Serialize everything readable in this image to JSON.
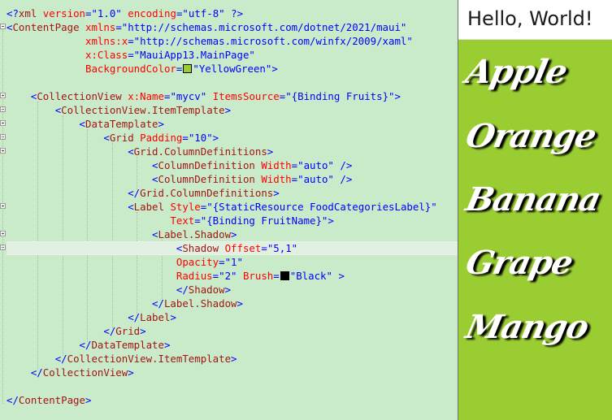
{
  "editor": {
    "lines": [
      "<?xml version=\"1.0\" encoding=\"utf-8\" ?>",
      "<ContentPage xmlns=\"http://schemas.microsoft.com/dotnet/2021/maui\"",
      "             xmlns:x=\"http://schemas.microsoft.com/winfx/2009/xaml\"",
      "             x:Class=\"MauiApp13.MainPage\"",
      "             BackgroundColor=\"YellowGreen\">",
      "",
      "    <CollectionView x:Name=\"mycv\" ItemsSource=\"{Binding Fruits}\">",
      "        <CollectionView.ItemTemplate>",
      "            <DataTemplate>",
      "                <Grid Padding=\"10\">",
      "                    <Grid.ColumnDefinitions>",
      "                        <ColumnDefinition Width=\"auto\" />",
      "                        <ColumnDefinition Width=\"auto\" />",
      "                    </Grid.ColumnDefinitions>",
      "                    <Label Style=\"{StaticResource FoodCategoriesLabel}\"",
      "                           Text=\"{Binding FruitName}\">",
      "                        <Label.Shadow>",
      "                            <Shadow Offset=\"5,1\"",
      "                            Opacity=\"1\"",
      "                            Radius=\"2\" Brush=\"Black\" >",
      "                            </Shadow>",
      "                        </Label.Shadow>",
      "                    </Label>",
      "                </Grid>",
      "            </DataTemplate>",
      "        </CollectionView.ItemTemplate>",
      "    </CollectionView>",
      "",
      "</ContentPage>"
    ],
    "colors": {
      "background": "#c9ebc9",
      "element": "#a31515",
      "attribute": "#ff0000",
      "value": "#0000ff",
      "swatch_yellowgreen": "#9acd32",
      "swatch_black": "#000000"
    }
  },
  "preview": {
    "title": "Hello, World!",
    "background": "#9acd32",
    "fruits": [
      "Apple",
      "Orange",
      "Banana",
      "Grape",
      "Mango"
    ]
  }
}
